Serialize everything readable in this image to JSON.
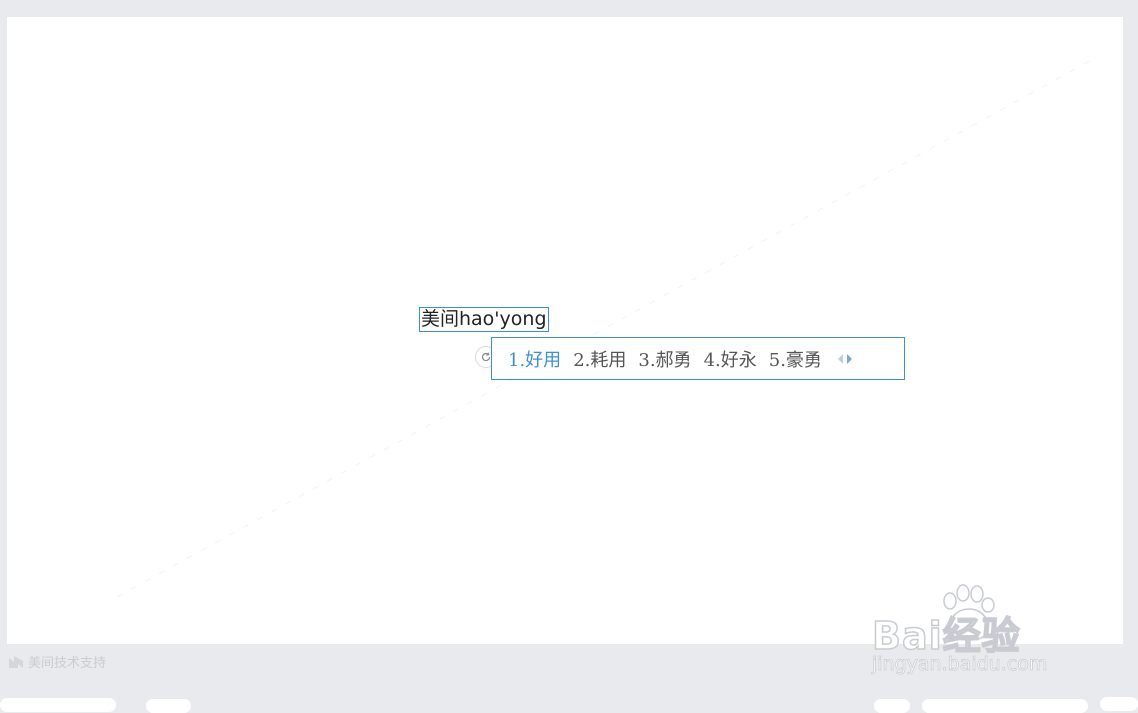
{
  "editor": {
    "input_text": "美间hao'yong"
  },
  "ime": {
    "candidates": [
      {
        "label": "1.好用",
        "active": true
      },
      {
        "label": "2.耗用",
        "active": false
      },
      {
        "label": "3.郝勇",
        "active": false
      },
      {
        "label": "4.好永",
        "active": false
      },
      {
        "label": "5.豪勇",
        "active": false
      }
    ],
    "refresh_icon": "refresh-icon",
    "page_arrows": [
      "arrow-left-icon",
      "arrow-right-icon"
    ]
  },
  "footer": {
    "support_text": "美间技术支持"
  },
  "watermark": {
    "brand": "Bai经验",
    "url": "jingyan.baidu.com"
  },
  "colors": {
    "accent": "#3b8fd8",
    "background": "#e9eaed",
    "canvas": "#ffffff"
  }
}
